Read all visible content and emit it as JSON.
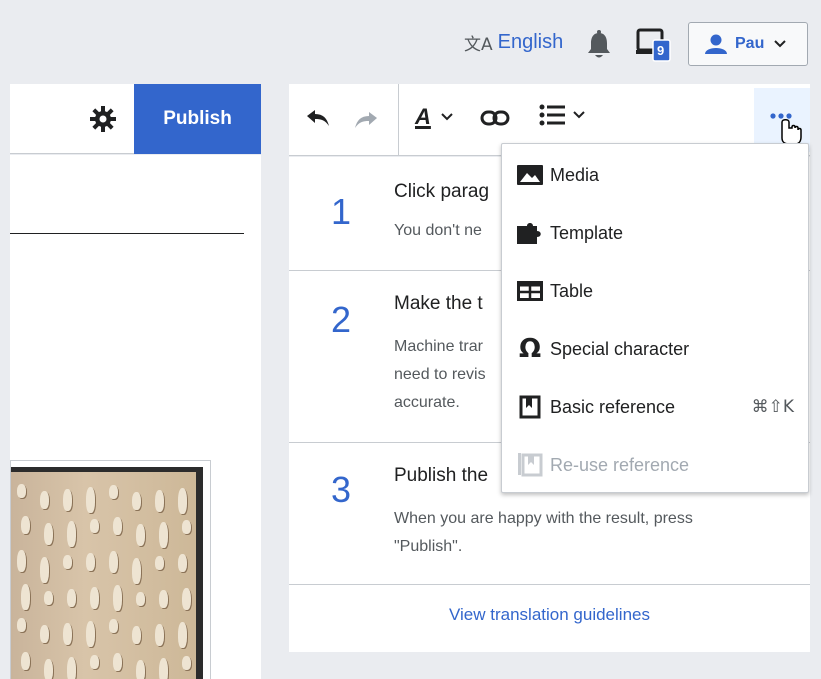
{
  "header": {
    "language_label": "English",
    "language_icon": "文A",
    "notifications_icon": "bell-icon",
    "devices_badge": "9",
    "user_name": "Pau",
    "user_chevron": "⌄"
  },
  "editor": {
    "publish_label": "Publish",
    "settings_icon": "gear-icon"
  },
  "toolbar": {
    "undo_icon": "undo-icon",
    "redo_icon": "redo-icon",
    "text_style_icon": "text-style-icon",
    "link_icon": "link-icon",
    "list_icon": "list-icon",
    "more_icon": "ellipsis-icon"
  },
  "menu": {
    "items": [
      {
        "label": "Media",
        "icon": "image-icon",
        "shortcut": ""
      },
      {
        "label": "Template",
        "icon": "puzzle-icon",
        "shortcut": ""
      },
      {
        "label": "Table",
        "icon": "table-icon",
        "shortcut": ""
      },
      {
        "label": "Special character",
        "icon": "omega-icon",
        "shortcut": ""
      },
      {
        "label": "Basic reference",
        "icon": "reference-icon",
        "shortcut": "⌘⇧K"
      },
      {
        "label": "Re-use reference",
        "icon": "reuse-reference-icon",
        "shortcut": "",
        "disabled": true
      }
    ]
  },
  "guidelines": {
    "steps": [
      {
        "number": "1",
        "title": "Click parag",
        "desc": [
          "You don't ne"
        ]
      },
      {
        "number": "2",
        "title": "Make the t",
        "desc": [
          "Machine trar",
          "need to revis",
          "accurate."
        ]
      },
      {
        "number": "3",
        "title": "Publish the",
        "desc": [
          "When you are happy with the result, press",
          "\"Publish\"."
        ]
      }
    ],
    "link_label": "View translation guidelines"
  },
  "colors": {
    "accent": "#3366cc",
    "background": "#eaecf0",
    "border": "#c8ccd1"
  }
}
